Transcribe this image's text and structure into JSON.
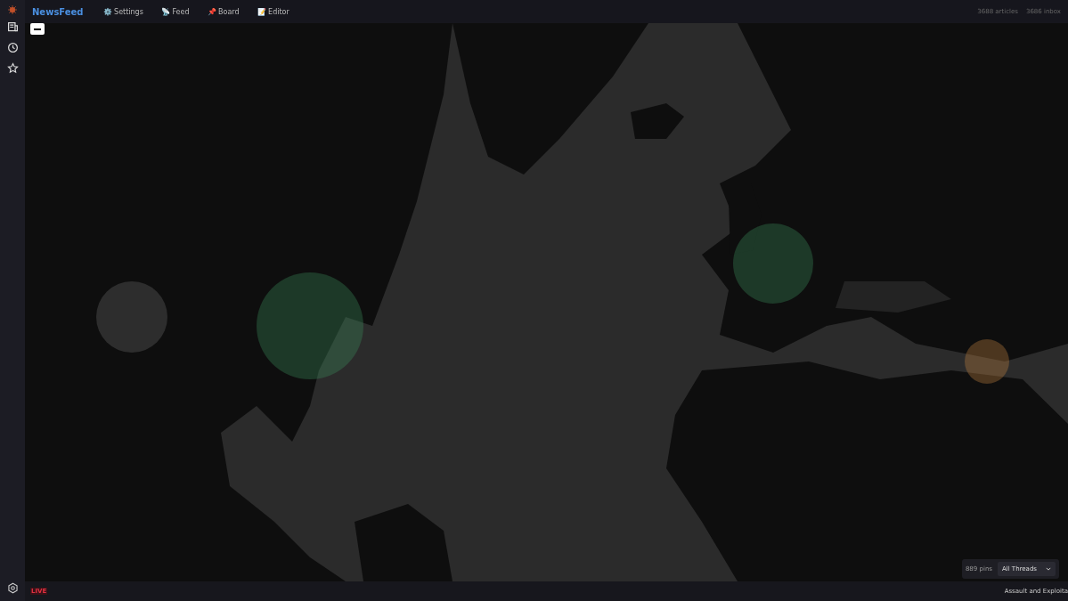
{
  "app": {
    "title": "NewsFeed"
  },
  "nav": [
    {
      "icon": "⚙️",
      "label": "Settings"
    },
    {
      "icon": "📡",
      "label": "Feed"
    },
    {
      "icon": "📌",
      "label": "Board"
    },
    {
      "icon": "📝",
      "label": "Editor"
    }
  ],
  "stats": [
    "3688 articles",
    "3686 inbox"
  ],
  "sidebar": {
    "items": [
      {
        "kind": "feed"
      },
      {
        "kind": "history"
      },
      {
        "kind": "star"
      }
    ]
  },
  "map": {
    "kind": "picture",
    "pin_count": "889 pins",
    "filter": {
      "value": "All Threads"
    }
  },
  "status_bar": {
    "live": "LIVE",
    "ticker": "Assault and Exploita"
  }
}
